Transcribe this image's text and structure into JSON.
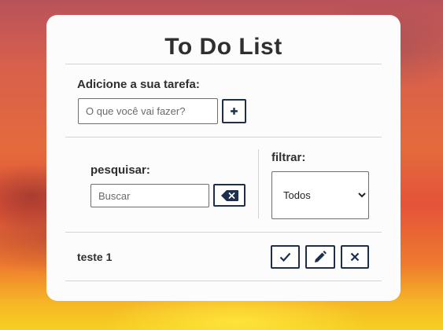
{
  "app": {
    "title": "To Do List"
  },
  "add_task": {
    "label": "Adicione a sua tarefa:",
    "input_value": "",
    "input_placeholder": "O que você vai fazer?",
    "add_button_symbol": "+"
  },
  "search": {
    "label": "pesquisar:",
    "input_value": "",
    "input_placeholder": "Buscar",
    "clear_icon": "backspace-icon"
  },
  "filter": {
    "label": "filtrar:",
    "selected": "Todos",
    "options": [
      "Todos"
    ]
  },
  "tasks": [
    {
      "text": "teste 1",
      "actions": [
        "check-icon",
        "pencil-icon",
        "close-icon"
      ]
    }
  ],
  "colors": {
    "accent": "#1d2f4d",
    "card_background": "#fcfcfc",
    "text": "#2f2f2f"
  }
}
